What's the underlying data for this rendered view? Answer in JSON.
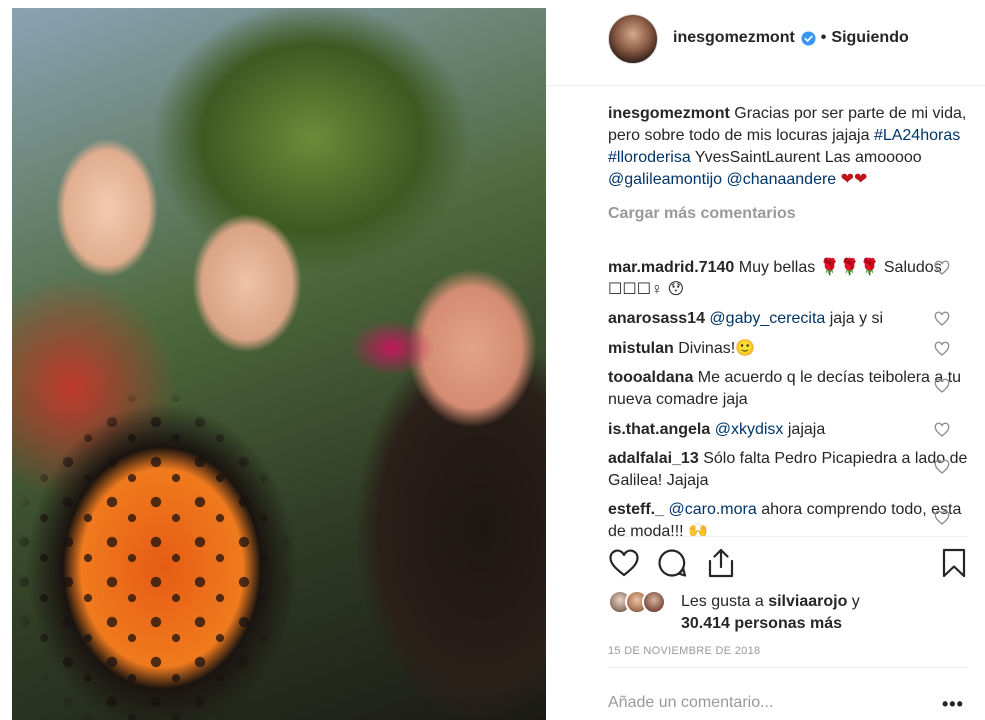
{
  "post": {
    "header": {
      "username": "inesgomezmont",
      "separator": "•",
      "follow_status": "Siguiendo"
    },
    "caption": {
      "username": "inesgomezmont",
      "text_1": "Gracias por ser parte de mi vida, pero sobre todo de mis locuras jajaja",
      "hashtag_1": "#LA24horas",
      "hashtag_2": "#lloroderisa",
      "text_2": "YvesSaintLaurent Las amooooo",
      "mention_1": "@galileamontijo",
      "mention_2": "@chanaandere",
      "emoji": "❤❤"
    },
    "load_more": "Cargar más comentarios",
    "comments": [
      {
        "user": "mar.madrid.7140",
        "text": "Muy bellas 🌹🌹🌹 Saludos ☐☐☐♀ 😯"
      },
      {
        "user": "anarosass14",
        "mention": "@gaby_cerecita",
        "text": "jaja y si"
      },
      {
        "user": "mistulan",
        "text": "Divinas!🙂"
      },
      {
        "user": "toooaldana",
        "text": "Me acuerdo q le decías teibolera a tu nueva comadre jaja"
      },
      {
        "user": "is.that.angela",
        "mention": "@xkydisx",
        "text": "jajaja"
      },
      {
        "user": "adalfalai_13",
        "text": "Sólo falta Pedro Picapiedra a lado de Galilea! Jajaja"
      },
      {
        "user": "esteff._",
        "mention": "@caro.mora",
        "text": "ahora comprendo todo, esta de moda!!! 🙌"
      }
    ],
    "likes": {
      "prefix": "Les gusta a",
      "user": "silviaarojo",
      "joiner": "y",
      "count": "30.414 personas más"
    },
    "date": "15 DE NOVIEMBRE DE 2018",
    "add_comment_placeholder": "Añade un comentario...",
    "more_label": "•••"
  },
  "icons": {
    "verified": "verified-badge-icon",
    "like": "heart-icon",
    "comment": "speech-bubble-icon",
    "share": "share-icon",
    "save": "bookmark-icon"
  },
  "colors": {
    "link": "#003569",
    "verified": "#3897f0",
    "muted": "#999999",
    "text": "#262626"
  }
}
